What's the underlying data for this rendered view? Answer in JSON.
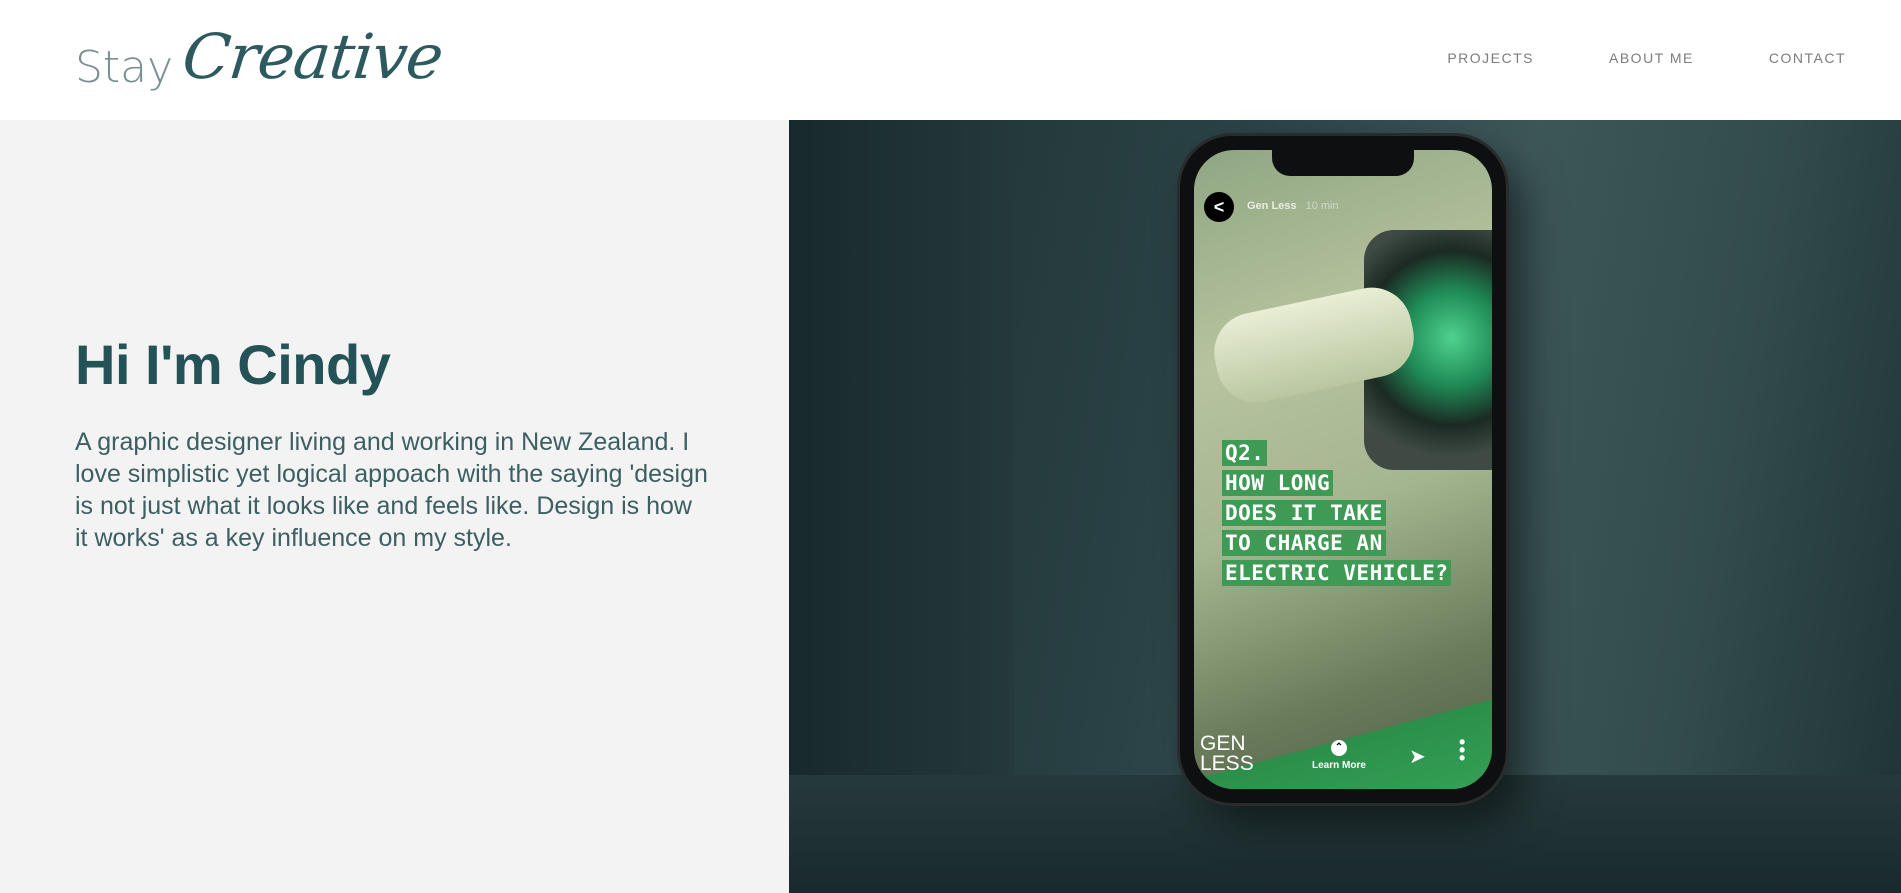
{
  "header": {
    "logo_stay": "Stay",
    "logo_creative": "Creative",
    "nav": [
      "PROJECTS",
      "ABOUT ME",
      "CONTACT"
    ]
  },
  "hero": {
    "title": "Hi I'm Cindy",
    "text": "A graphic designer living and working in New Zealand. I love simplistic yet logical appoach with the saying 'design is not just what it looks like and feels like. Design is how it works' as a key influence on my style."
  },
  "phone": {
    "story_user": "Gen Less",
    "story_time": "10 min",
    "question_lines": [
      "Q2.",
      "HOW LONG",
      "DOES IT TAKE",
      "TO CHARGE AN",
      "ELECTRIC VEHICLE?"
    ],
    "brand_line1": "GEN",
    "brand_line2": "LESS",
    "learn_more": "Learn More"
  },
  "colors": {
    "accent": "#245357",
    "left_bg": "#f3f3f3",
    "story_green": "#3e9a55"
  }
}
